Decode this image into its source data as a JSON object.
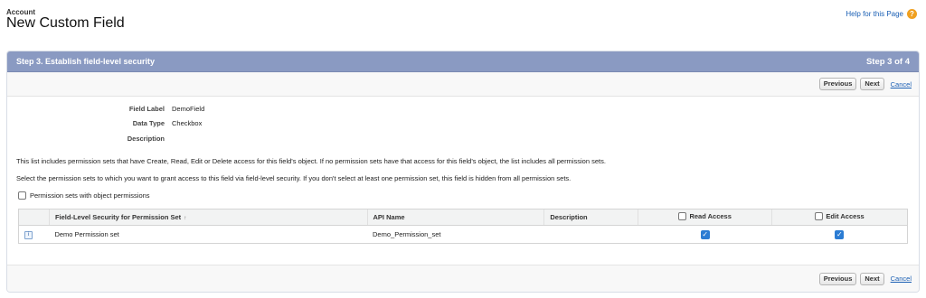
{
  "header": {
    "breadcrumb": "Account",
    "title": "New Custom Field",
    "help_link": "Help for this Page",
    "help_icon": "?"
  },
  "step": {
    "title": "Step 3. Establish field-level security",
    "indicator": "Step 3 of 4"
  },
  "buttons": {
    "previous": "Previous",
    "next": "Next",
    "cancel": "Cancel"
  },
  "field_info": [
    {
      "label": "Field Label",
      "value": "DemoField"
    },
    {
      "label": "Data Type",
      "value": "Checkbox"
    },
    {
      "label": "Description",
      "value": ""
    }
  ],
  "info_text": {
    "line1": "This list includes permission sets that have Create, Read, Edit or Delete access for this field's object. If no permission sets have that access for this field's object, the list includes all permission sets.",
    "line2": "Select the permission sets to which you want to grant access to this field via field-level security. If you don't select at least one permission set, this field is hidden from all permission sets."
  },
  "filter_checkbox_label": "Permission sets with object permissions",
  "table": {
    "columns": {
      "name": "Field-Level Security for Permission Set",
      "sort_icon": "↑",
      "api_name": "API Name",
      "description": "Description",
      "read_access": "Read Access",
      "edit_access": "Edit Access"
    },
    "rows": [
      {
        "row_icon": "i",
        "name": "Demo Permission set",
        "api_name": "Demo_Permission_set",
        "description": "",
        "read_access": true,
        "edit_access": true
      }
    ]
  },
  "colors": {
    "step_bar": "#8a9ac2",
    "link": "#1a5fb4",
    "checkbox_checked": "#2b7cd3",
    "help_icon": "#f0a020"
  }
}
